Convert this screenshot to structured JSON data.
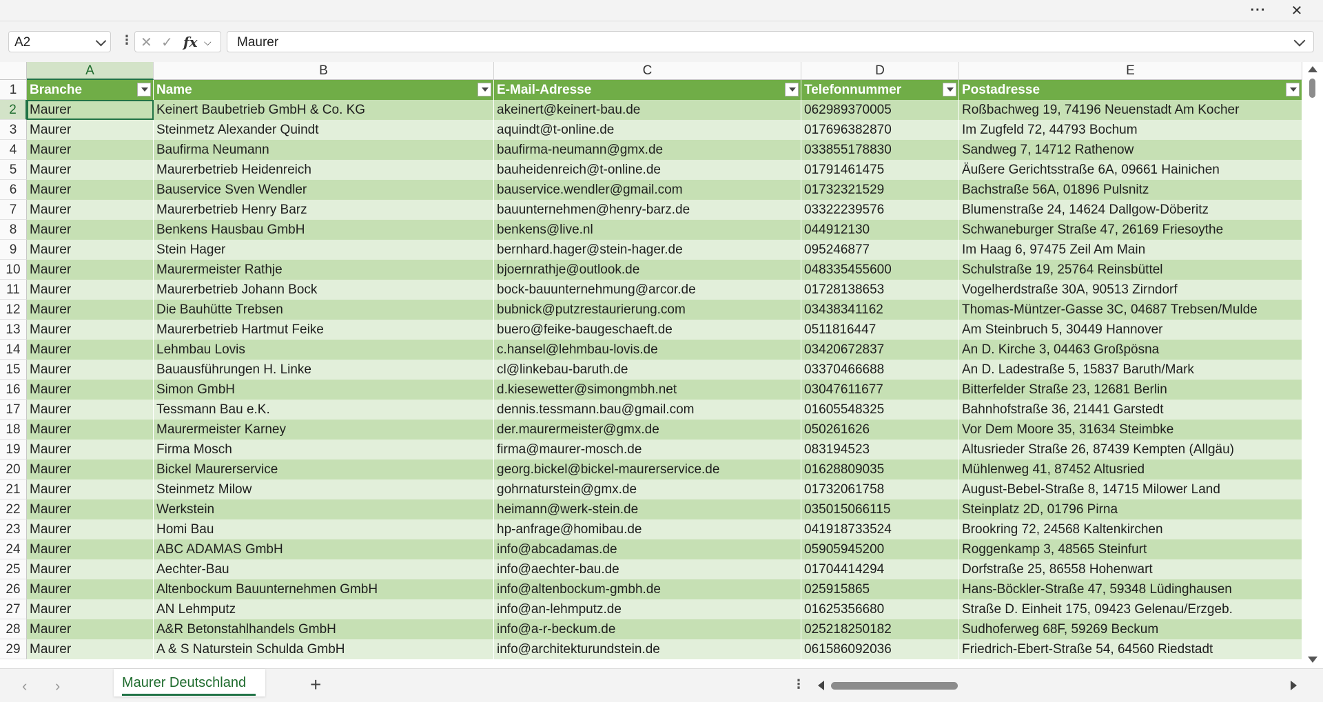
{
  "window": {
    "more_label": "···",
    "close_label": "✕"
  },
  "formula_bar": {
    "name_box": "A2",
    "formula": "Maurer",
    "cancel_icon": "✕",
    "enter_icon": "✓",
    "fx_label": "fx",
    "chevron": "⌵"
  },
  "columns": [
    "A",
    "B",
    "C",
    "D",
    "E"
  ],
  "header": [
    "Branche",
    "Name",
    "E-Mail-Adresse",
    "Telefonnummer",
    "Postadresse"
  ],
  "rows": [
    [
      "2",
      "Maurer",
      "Keinert Baubetrieb GmbH & Co. KG",
      "akeinert@keinert-bau.de",
      "062989370005",
      "Roßbachweg 19, 74196 Neuenstadt Am Kocher"
    ],
    [
      "3",
      "Maurer",
      "Steinmetz Alexander Quindt",
      "aquindt@t-online.de",
      "017696382870",
      "Im Zugfeld 72, 44793 Bochum"
    ],
    [
      "4",
      "Maurer",
      "Baufirma Neumann",
      "baufirma-neumann@gmx.de",
      "033855178830",
      "Sandweg 7, 14712 Rathenow"
    ],
    [
      "5",
      "Maurer",
      "Maurerbetrieb Heidenreich",
      "bauheidenreich@t-online.de",
      "01791461475",
      "Äußere Gerichtsstraße 6A, 09661 Hainichen"
    ],
    [
      "6",
      "Maurer",
      "Bauservice Sven Wendler",
      "bauservice.wendler@gmail.com",
      "01732321529",
      "Bachstraße 56A, 01896 Pulsnitz"
    ],
    [
      "7",
      "Maurer",
      "Maurerbetrieb Henry Barz",
      "bauunternehmen@henry-barz.de",
      "03322239576",
      "Blumenstraße 24, 14624 Dallgow-Döberitz"
    ],
    [
      "8",
      "Maurer",
      "Benkens Hausbau GmbH",
      "benkens@live.nl",
      "044912130",
      "Schwaneburger Straße 47, 26169 Friesoythe"
    ],
    [
      "9",
      "Maurer",
      "Stein Hager",
      "bernhard.hager@stein-hager.de",
      "095246877",
      "Im Haag 6, 97475 Zeil Am Main"
    ],
    [
      "10",
      "Maurer",
      "Maurermeister Rathje",
      "bjoernrathje@outlook.de",
      "048335455600",
      "Schulstraße 19, 25764 Reinsbüttel"
    ],
    [
      "11",
      "Maurer",
      "Maurerbetrieb Johann Bock",
      "bock-bauunternehmung@arcor.de",
      "01728138653",
      "Vogelherdstraße 30A, 90513 Zirndorf"
    ],
    [
      "12",
      "Maurer",
      "Die Bauhütte Trebsen",
      "bubnick@putzrestaurierung.com",
      "03438341162",
      "Thomas-Müntzer-Gasse 3C, 04687 Trebsen/Mulde"
    ],
    [
      "13",
      "Maurer",
      "Maurerbetrieb Hartmut Feike",
      "buero@feike-baugeschaeft.de",
      "0511816447",
      "Am Steinbruch 5, 30449 Hannover"
    ],
    [
      "14",
      "Maurer",
      "Lehmbau Lovis",
      "c.hansel@lehmbau-lovis.de",
      "03420672837",
      "An D. Kirche 3, 04463 Großpösna"
    ],
    [
      "15",
      "Maurer",
      "Bauausführungen H. Linke",
      "cl@linkebau-baruth.de",
      "03370466688",
      "An D. Ladestraße 5, 15837 Baruth/Mark"
    ],
    [
      "16",
      "Maurer",
      "Simon GmbH",
      "d.kiesewetter@simongmbh.net",
      "03047611677",
      "Bitterfelder Straße 23, 12681 Berlin"
    ],
    [
      "17",
      "Maurer",
      "Tessmann Bau e.K.",
      "dennis.tessmann.bau@gmail.com",
      "01605548325",
      "Bahnhofstraße 36, 21441 Garstedt"
    ],
    [
      "18",
      "Maurer",
      "Maurermeister Karney",
      "der.maurermeister@gmx.de",
      "050261626",
      "Vor Dem Moore 35, 31634 Steimbke"
    ],
    [
      "19",
      "Maurer",
      "Firma Mosch",
      "firma@maurer-mosch.de",
      "083194523",
      "Altusrieder Straße 26, 87439 Kempten (Allgäu)"
    ],
    [
      "20",
      "Maurer",
      "Bickel Maurerservice",
      "georg.bickel@bickel-maurerservice.de",
      "01628809035",
      "Mühlenweg 41, 87452 Altusried"
    ],
    [
      "21",
      "Maurer",
      "Steinmetz Milow",
      "gohrnaturstein@gmx.de",
      "01732061758",
      "August-Bebel-Straße 8, 14715 Milower Land"
    ],
    [
      "22",
      "Maurer",
      "Werkstein",
      "heimann@werk-stein.de",
      "035015066115",
      "Steinplatz 2D, 01796 Pirna"
    ],
    [
      "23",
      "Maurer",
      "Homi Bau",
      "hp-anfrage@homibau.de",
      "041918733524",
      "Brookring 72, 24568 Kaltenkirchen"
    ],
    [
      "24",
      "Maurer",
      "ABC ADAMAS GmbH",
      "info@abcadamas.de",
      "05905945200",
      "Roggenkamp 3, 48565 Steinfurt"
    ],
    [
      "25",
      "Maurer",
      "Aechter-Bau",
      "info@aechter-bau.de",
      "01704414294",
      "Dorfstraße 25, 86558 Hohenwart"
    ],
    [
      "26",
      "Maurer",
      "Altenbockum Bauunternehmen GmbH",
      "info@altenbockum-gmbh.de",
      "025915865",
      "Hans-Böckler-Straße 47, 59348 Lüdinghausen"
    ],
    [
      "27",
      "Maurer",
      "AN Lehmputz",
      "info@an-lehmputz.de",
      "01625356680",
      "Straße D. Einheit 175, 09423 Gelenau/Erzgeb."
    ],
    [
      "28",
      "Maurer",
      "A&R Betonstahlhandels GmbH",
      "info@a-r-beckum.de",
      "025218250182",
      "Sudhoferweg 68F, 59269 Beckum"
    ],
    [
      "29",
      "Maurer",
      "A & S Naturstein Schulda GmbH",
      "info@architekturundstein.de",
      "061586092036",
      "Friedrich-Ebert-Straße 54, 64560 Riedstadt"
    ]
  ],
  "sheet_tabs": {
    "active": "Maurer Deutschland",
    "add_label": "+"
  },
  "colors": {
    "header": "#70ad47",
    "band_light": "#e2efda",
    "band_dark": "#c6e0b4",
    "accent": "#217346"
  }
}
